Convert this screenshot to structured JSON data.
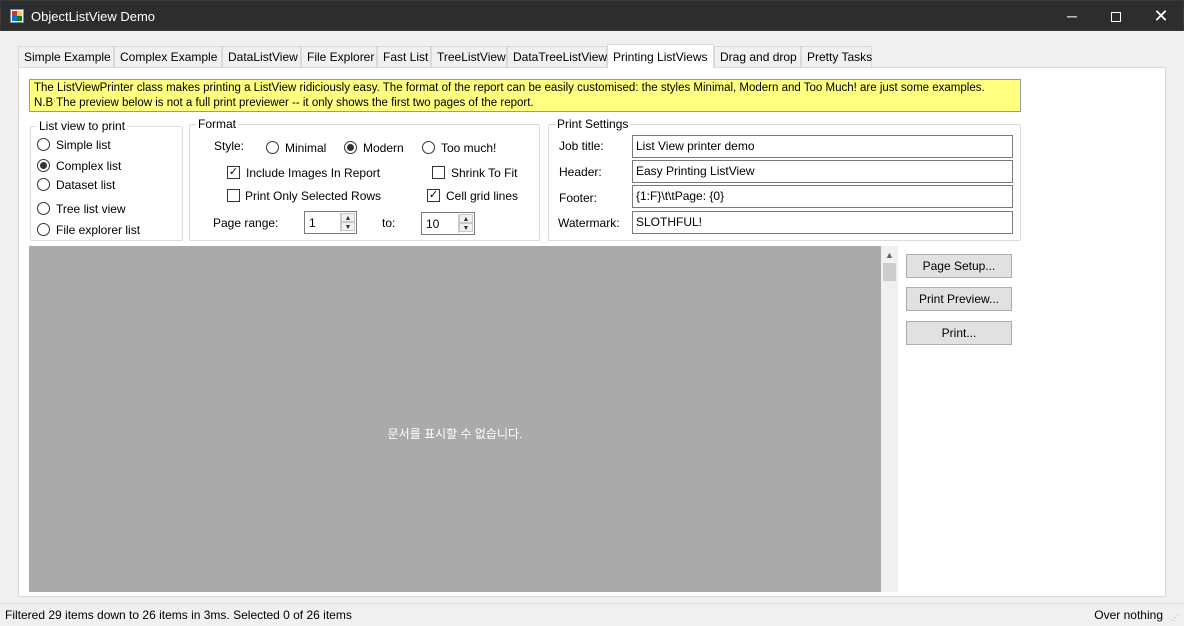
{
  "window": {
    "title": "ObjectListView Demo",
    "minimize_glyph": "─",
    "close_glyph": "✕"
  },
  "tabs": [
    {
      "label": "Simple Example"
    },
    {
      "label": "Complex Example"
    },
    {
      "label": "DataListView"
    },
    {
      "label": "File Explorer"
    },
    {
      "label": "Fast List"
    },
    {
      "label": "TreeListView"
    },
    {
      "label": "DataTreeListView"
    },
    {
      "label": "Printing ListViews",
      "active": true
    },
    {
      "label": "Drag and drop"
    },
    {
      "label": "Pretty Tasks"
    }
  ],
  "info": {
    "line1": "The ListViewPrinter class makes printing a ListView ridiciously easy. The format of the report can be easily customised: the styles Minimal, Modern and Too Much! are just some examples.",
    "line2": "N.B The preview below is not a full print previewer -- it only shows the first two pages of the report.",
    "background": "#ffff80"
  },
  "list_view_to_print": {
    "legend": "List view to print",
    "options": [
      {
        "label": "Simple list",
        "selected": false
      },
      {
        "label": "Complex list",
        "selected": true
      },
      {
        "label": "Dataset list",
        "selected": false
      },
      {
        "label": "Tree list view",
        "selected": false
      },
      {
        "label": "File explorer list",
        "selected": false
      }
    ]
  },
  "format": {
    "legend": "Format",
    "style_label": "Style:",
    "styles": [
      {
        "label": "Minimal",
        "selected": false
      },
      {
        "label": "Modern",
        "selected": true
      },
      {
        "label": "Too much!",
        "selected": false
      }
    ],
    "include_images": {
      "label": "Include Images In Report",
      "checked": true
    },
    "shrink_to_fit": {
      "label": "Shrink To Fit",
      "checked": false
    },
    "print_only_selected": {
      "label": "Print Only Selected Rows",
      "checked": false
    },
    "cell_grid_lines": {
      "label": "Cell grid lines",
      "checked": true
    },
    "page_range_label": "Page range:",
    "page_from": "1",
    "to_label": "to:",
    "page_to": "10",
    "check_glyph": "✓",
    "spin_up_glyph": "▲",
    "spin_down_glyph": "▼"
  },
  "print_settings": {
    "legend": "Print Settings",
    "job_title_label": "Job title:",
    "job_title_value": "List View printer demo",
    "header_label": "Header:",
    "header_value": "Easy Printing ListView",
    "footer_label": "Footer:",
    "footer_value": "{1:F}\\t\\tPage: {0}",
    "watermark_label": "Watermark:",
    "watermark_value": "SLOTHFUL!"
  },
  "preview": {
    "message": "문서를 표시할 수 없습니다.",
    "scroll_up_glyph": "▲",
    "background": "#aaaaaa"
  },
  "buttons": {
    "page_setup": "Page Setup...",
    "print_preview": "Print Preview...",
    "print": "Print..."
  },
  "status": {
    "left": "Filtered 29 items down to 26 items in 3ms. Selected 0 of 26 items",
    "right": "Over nothing",
    "grip_glyph": "⋰"
  }
}
